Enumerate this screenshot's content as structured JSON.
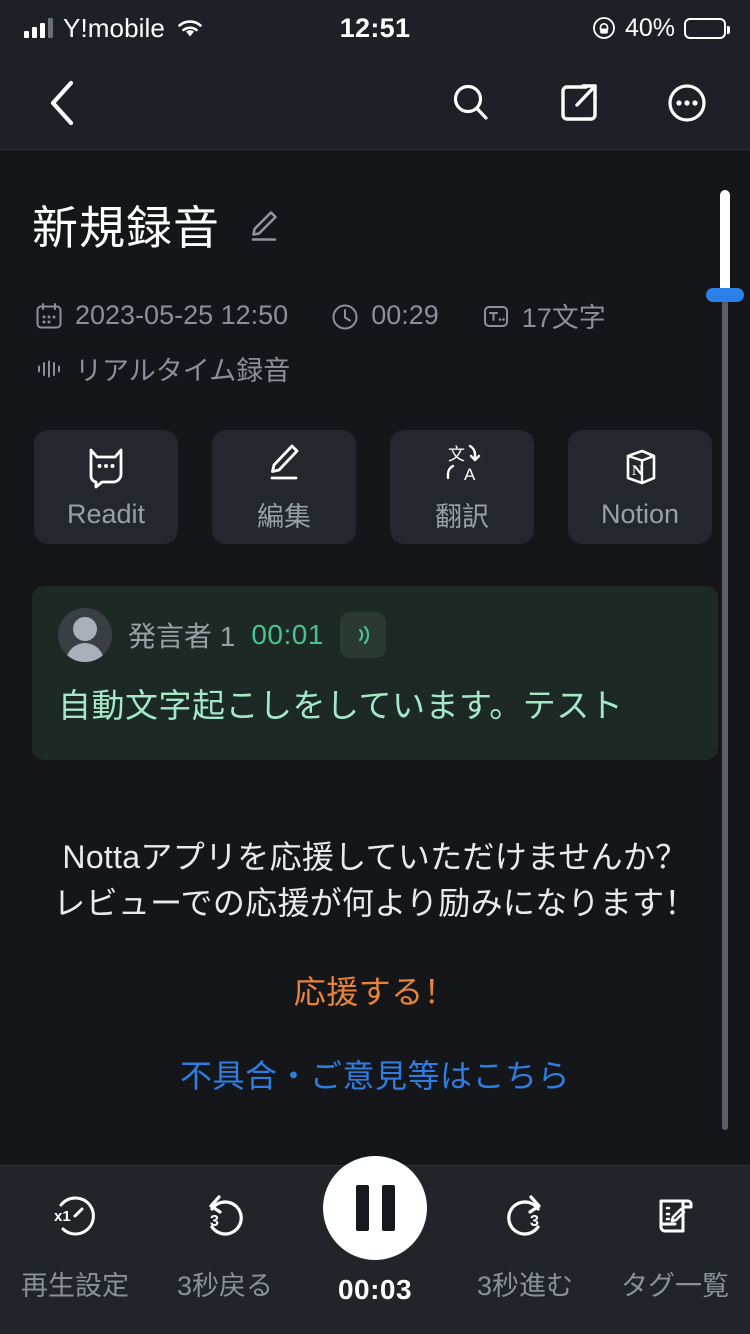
{
  "status_bar": {
    "carrier": "Y!mobile",
    "time": "12:51",
    "battery_percent": "40%",
    "signal_icon": "cellular-bars-icon",
    "wifi_icon": "wifi-icon",
    "lock_icon": "rotation-lock-icon",
    "battery_icon": "battery-charging-icon",
    "battery_color": "#3ddc53"
  },
  "nav_bar": {
    "back_icon": "back-chevron-icon",
    "search_icon": "search-icon",
    "share_icon": "share-export-icon",
    "more_icon": "more-options-icon"
  },
  "recording": {
    "title": "新規録音",
    "edit_icon": "pencil-edit-icon",
    "meta": {
      "date_icon": "calendar-icon",
      "date": "2023-05-25 12:50",
      "duration_icon": "clock-icon",
      "duration": "00:29",
      "chars_icon": "text-count-icon",
      "chars": "17文字",
      "mode_icon": "waveform-icon",
      "mode": "リアルタイム録音"
    }
  },
  "chips": [
    {
      "label": "Readit",
      "icon": "readit-cat-icon"
    },
    {
      "label": "編集",
      "icon": "pencil-edit-icon"
    },
    {
      "label": "翻訳",
      "icon": "translate-icon"
    },
    {
      "label": "Notion",
      "icon": "notion-cube-icon"
    }
  ],
  "transcript": {
    "speaker": "発言者 1",
    "timestamp": "00:01",
    "audio_icon": "sound-wave-icon",
    "avatar_icon": "user-avatar-icon",
    "text": "自動文字起こしをしています。テスト",
    "card_color": "#1d2924",
    "text_color": "#a5e8c8",
    "time_color": "#49c38e"
  },
  "promo": {
    "message": "Nottaアプリを応援していただけませんか？レビューでの応援が何より励みになります！",
    "cta_label": "応援する！",
    "cta_color": "#e8833a",
    "link_label": "不具合・ご意見等はこちら",
    "link_color": "#2f7de0"
  },
  "scroll_slider": {
    "name": "vertical-scroll-slider",
    "thumb_color": "#2b7fe8"
  },
  "player": {
    "speed": {
      "label": "再生設定",
      "icon": "playback-speed-x1-icon"
    },
    "rewind": {
      "label": "3秒戻る",
      "icon": "rewind-3-icon"
    },
    "play": {
      "label": "00:03",
      "icon": "pause-icon"
    },
    "forward": {
      "label": "3秒進む",
      "icon": "forward-3-icon"
    },
    "tags": {
      "label": "タグ一覧",
      "icon": "tag-list-icon"
    }
  }
}
